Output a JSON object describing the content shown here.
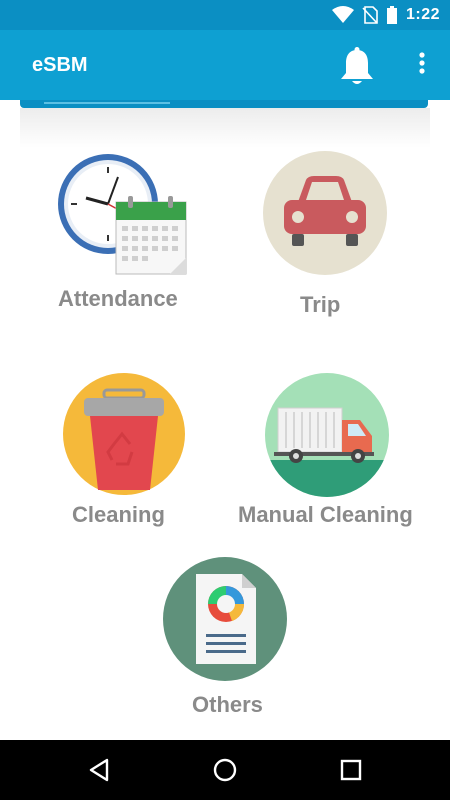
{
  "status_bar": {
    "time": "1:22",
    "icons": [
      "wifi-icon",
      "no-sim-icon",
      "battery-icon"
    ]
  },
  "app_bar": {
    "title": "eSBM",
    "icons": [
      "bell-icon",
      "overflow-menu-icon"
    ]
  },
  "tiles": [
    {
      "label": "Attendance",
      "icon": "clock-calendar-icon"
    },
    {
      "label": "Trip",
      "icon": "car-icon"
    },
    {
      "label": "Cleaning",
      "icon": "trash-bin-icon"
    },
    {
      "label": "Manual Cleaning",
      "icon": "truck-icon"
    },
    {
      "label": "Others",
      "icon": "report-document-icon"
    }
  ],
  "nav_bar": {
    "icons": [
      "back-icon",
      "home-icon",
      "recents-icon"
    ]
  },
  "colors": {
    "status_bar": "#0b8fc3",
    "app_bar": "#0ea0d2",
    "label_gray": "#8a8a8a"
  }
}
